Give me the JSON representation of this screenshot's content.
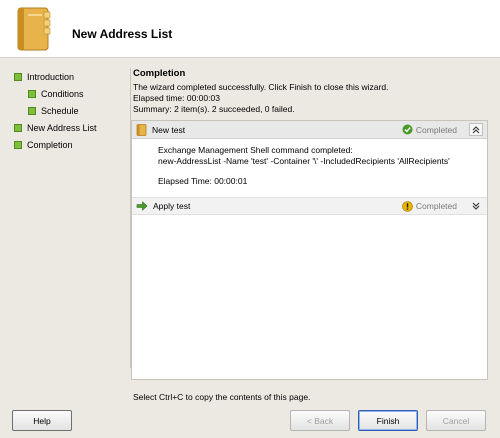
{
  "header": {
    "title": "New Address List",
    "icon": "address-book-icon"
  },
  "nav": {
    "items": [
      {
        "label": "Introduction",
        "level": 0
      },
      {
        "label": "Conditions",
        "level": 1
      },
      {
        "label": "Schedule",
        "level": 1
      },
      {
        "label": "New Address List",
        "level": 0
      },
      {
        "label": "Completion",
        "level": 0
      }
    ]
  },
  "content": {
    "heading": "Completion",
    "message": "The wizard completed successfully. Click Finish to close this wizard.",
    "elapsed": "Elapsed time: 00:00:03",
    "summary": "Summary: 2 item(s). 2 succeeded, 0 failed."
  },
  "tasks": [
    {
      "name": "New test",
      "status": "Completed",
      "body_line1": "Exchange Management Shell command completed:",
      "body_line2": "new-AddressList -Name 'test' -Container '\\' -IncludedRecipients 'AllRecipients'",
      "body_elapsed": "Elapsed Time: 00:00:01"
    },
    {
      "name": "Apply test",
      "status": "Completed"
    }
  ],
  "footer": {
    "hint": "Select Ctrl+C to copy the contents of this page.",
    "help": "Help",
    "back": "< Back",
    "finish": "Finish",
    "cancel": "Cancel"
  },
  "colors": {
    "nav_square": "#7bbf3a",
    "success": "#4a9a2a",
    "warning": "#e8b400"
  }
}
